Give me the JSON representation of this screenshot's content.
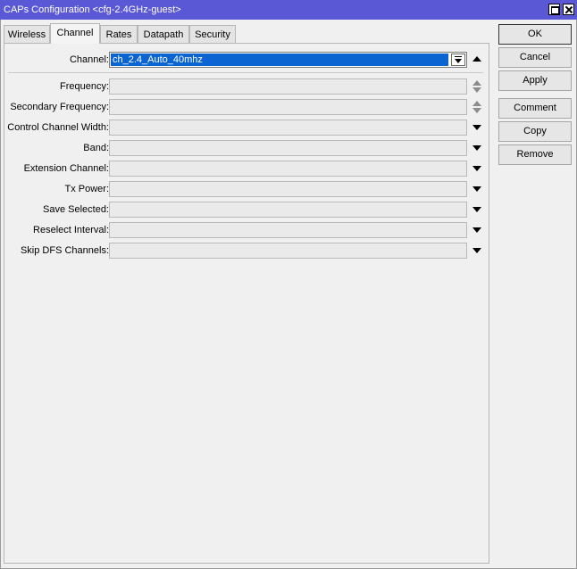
{
  "window": {
    "title": "CAPs Configuration <cfg-2.4GHz-guest>"
  },
  "tabs": [
    {
      "label": "Wireless"
    },
    {
      "label": "Channel"
    },
    {
      "label": "Rates"
    },
    {
      "label": "Datapath"
    },
    {
      "label": "Security"
    }
  ],
  "active_tab": "Channel",
  "form": {
    "channel": {
      "label": "Channel:",
      "value": "ch_2.4_Auto_40mhz"
    },
    "frequency": {
      "label": "Frequency:",
      "value": ""
    },
    "secondary_frequency": {
      "label": "Secondary Frequency:",
      "value": ""
    },
    "control_channel_width": {
      "label": "Control Channel Width:",
      "value": ""
    },
    "band": {
      "label": "Band:",
      "value": ""
    },
    "extension_channel": {
      "label": "Extension Channel:",
      "value": ""
    },
    "tx_power": {
      "label": "Tx Power:",
      "value": ""
    },
    "save_selected": {
      "label": "Save Selected:",
      "value": ""
    },
    "reselect_interval": {
      "label": "Reselect Interval:",
      "value": ""
    },
    "skip_dfs_channels": {
      "label": "Skip DFS Channels:",
      "value": ""
    }
  },
  "buttons": {
    "ok": "OK",
    "cancel": "Cancel",
    "apply": "Apply",
    "comment": "Comment",
    "copy": "Copy",
    "remove": "Remove"
  },
  "colors": {
    "titlebar": "#5b58d6",
    "selection": "#0a64d1"
  }
}
